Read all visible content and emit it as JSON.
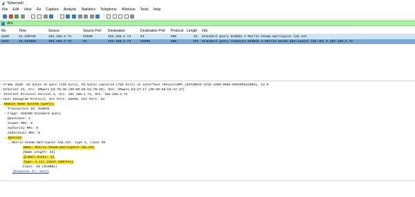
{
  "window": {
    "title": "*Ethernet0"
  },
  "menu": [
    "File",
    "Edit",
    "View",
    "Go",
    "Capture",
    "Analyze",
    "Statistics",
    "Telephony",
    "Wireless",
    "Tools",
    "Help"
  ],
  "filter": {
    "value": "dns"
  },
  "columns": [
    "No.",
    "Time",
    "Source",
    "Source Port",
    "Destination",
    "Destination Port",
    "Protocol",
    "Length",
    "Info"
  ],
  "packets": [
    {
      "no": "1520",
      "time": "24.190765",
      "source": "192.168.2.74",
      "source_port": "54590",
      "destination": "192.168.2.73",
      "destination_port": "53",
      "protocol": "DNS",
      "length": "91",
      "info": "Standard query 0xd0d4 A Matrix-Veeam.matrixpost-lab.net"
    },
    {
      "no": "1521",
      "time": "24.191666",
      "source": "192.168.2.73",
      "source_port": "53",
      "destination": "192.168.2.74",
      "destination_port": "54590",
      "protocol": "DNS",
      "length": "107",
      "info": "Standard query response 0xd0d4 A Matrix-Veeam.matrixpost-lab.net A 192.168.2.73"
    }
  ],
  "details": {
    "frame": "Frame 1520: 91 bytes on wire (728 bits), 91 bytes captured (728 bits) on interface \\Device\\NPF_{6372BD42-3722-4AE0-9066-568A0F62230S}, id 0",
    "ethernet": "Ethernet II, Src: VMware_b3:70:48 (00:50:56:b3:70:48), Dst: VMware_b3:27:17 (00:50:56:b3:27:17)",
    "ip": "Internet Protocol Version 4, Src: 192.168.2.74, Dst: 192.168.2.73",
    "udp": "User Datagram Protocol, Src Port: 54590, Dst Port: 53",
    "dns": "Domain Name System (query)",
    "transaction_id": "Transaction ID: 0xd0d4",
    "flags": "Flags: 0x0100 Standard query",
    "questions": "Questions: 1",
    "answer_rrs": "Answer RRs: 0",
    "authority_rrs": "Authority RRs: 0",
    "additional_rrs": "Additional RRs: 0",
    "queries": "Queries",
    "query_entry": "Matrix-Veeam.matrixpost-lab.net: type A, class IN",
    "name": "Name: Matrix-Veeam.matrixpost-lab.net",
    "name_length": "[Name Length: 31]",
    "label_count": "[Label Count: 3]",
    "type": "Type: A (1) (Host Address)",
    "class": "Class: IN (0x0001)",
    "response_in": "[Response In: 1521]"
  }
}
